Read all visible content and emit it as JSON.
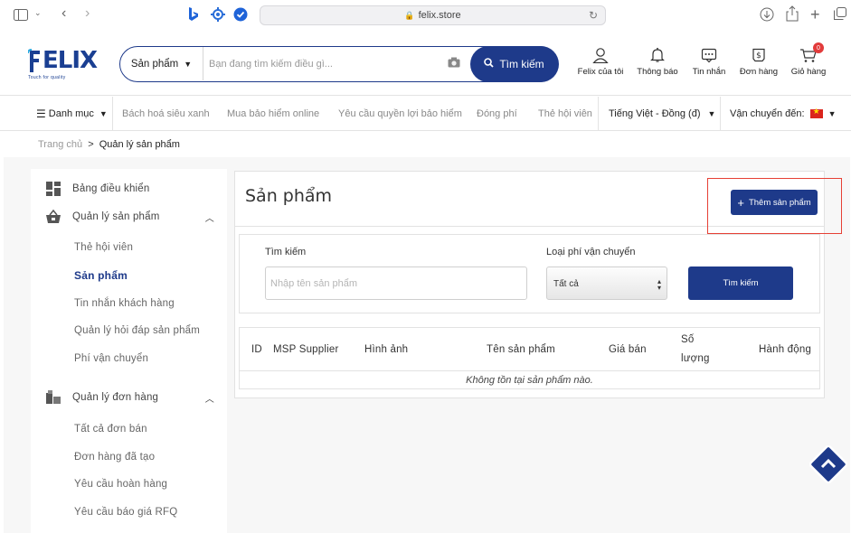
{
  "browser": {
    "url": "felix.store"
  },
  "header": {
    "logo_word": "ELIX",
    "logo_tagline": "Touch for quality",
    "search_category": "Sản phẩm",
    "search_placeholder": "Bạn đang tìm kiếm điều gì...",
    "search_button": "Tìm kiếm",
    "actions": [
      {
        "label": "Felix của tôi",
        "icon": "user-icon"
      },
      {
        "label": "Thông báo",
        "icon": "bell-icon"
      },
      {
        "label": "Tin nhắn",
        "icon": "message-icon"
      },
      {
        "label": "Đơn hàng",
        "icon": "order-icon"
      },
      {
        "label": "Giỏ hàng",
        "icon": "cart-icon",
        "badge": "0"
      }
    ]
  },
  "nav": {
    "categories": "Danh mục",
    "links": [
      "Bách hoá siêu xanh",
      "Mua bảo hiểm online",
      "Yêu cầu quyền lợi bảo hiểm",
      "Đóng phí",
      "Thẻ hội viên"
    ],
    "language": "Tiếng Việt - Đồng (đ)",
    "shipping_label": "Vận chuyển đến:"
  },
  "breadcrumb": {
    "home": "Trang chủ",
    "separator": ">",
    "current": "Quản lý sản phẩm"
  },
  "sidebar": {
    "dashboard": "Bảng điều khiển",
    "products_group": "Quản lý sản phẩm",
    "products_items": [
      "Thẻ hội viên",
      "Sản phẩm",
      "Tin nhắn khách hàng",
      "Quản lý hỏi đáp sản phẩm",
      "Phí vận chuyển"
    ],
    "active_item": "Sản phẩm",
    "orders_group": "Quản lý đơn hàng",
    "orders_items": [
      "Tất cả đơn bán",
      "Đơn hàng đã tạo",
      "Yêu cầu hoàn hàng",
      "Yêu cầu báo giá RFQ"
    ]
  },
  "main": {
    "title": "Sản phẩm",
    "add_button": "Thêm sản phẩm",
    "filter": {
      "search_label": "Tìm kiếm",
      "search_placeholder": "Nhập tên sản phẩm",
      "shipping_label": "Loại phí vận chuyển",
      "shipping_value": "Tất cả",
      "submit": "Tìm kiếm"
    },
    "table": {
      "columns": [
        "ID",
        "MSP Supplier",
        "Hình ảnh",
        "Tên sản phẩm",
        "Giá bán",
        "Số lượng",
        "Hành động"
      ],
      "empty_message": "Không tồn tại sản phẩm nào."
    }
  },
  "colors": {
    "primary": "#1e3a8a",
    "highlight": "#e64035",
    "badge": "#e23b3b"
  }
}
